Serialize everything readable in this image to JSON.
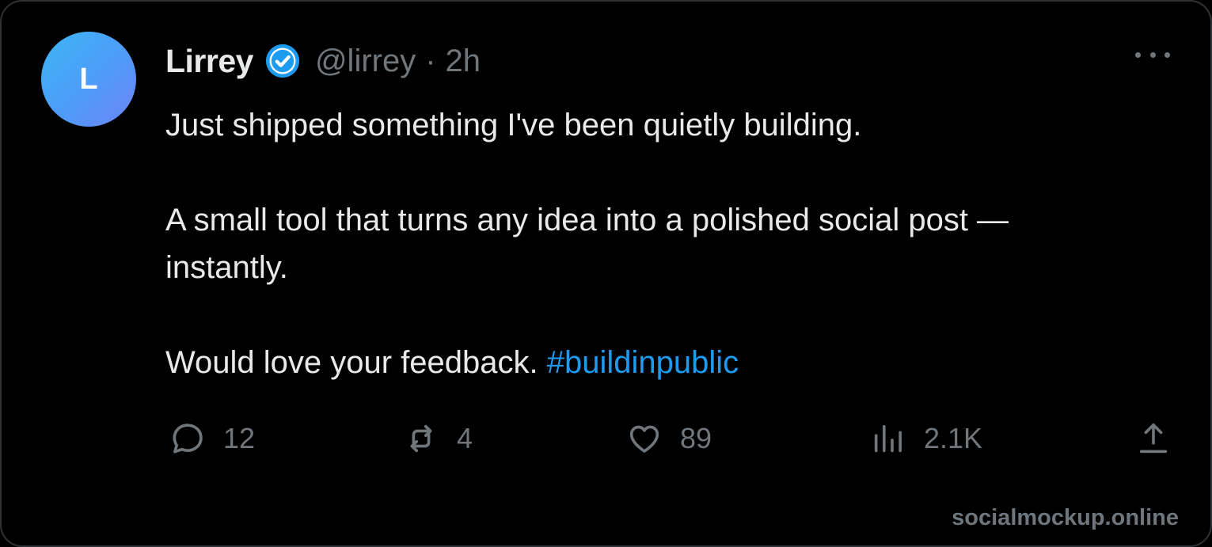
{
  "post": {
    "avatar_initial": "L",
    "display_name": "Lirrey",
    "handle": "@lirrey",
    "separator": "·",
    "time": "2h",
    "verified": true,
    "body": {
      "line1": "Just shipped something I've been quietly building.",
      "line2": "A small tool that turns any idea into a polished social post —",
      "line3": "instantly.",
      "line4_text": "Would love your feedback.",
      "hashtag": "#buildinpublic"
    },
    "actions": {
      "replies": "12",
      "reposts": "4",
      "likes": "89",
      "views": "2.1K"
    }
  },
  "watermark": "socialmockup.online",
  "icons": {
    "more": "more-horizontal-icon",
    "verified": "verified-badge-icon",
    "reply": "reply-icon",
    "repost": "repost-icon",
    "like": "heart-icon",
    "views": "views-chart-icon",
    "share": "share-upload-icon"
  },
  "colors": {
    "background": "#000000",
    "border": "#2f3336",
    "primary_text": "#e7e9ea",
    "secondary_text": "#71767b",
    "accent": "#1d9bf0"
  }
}
